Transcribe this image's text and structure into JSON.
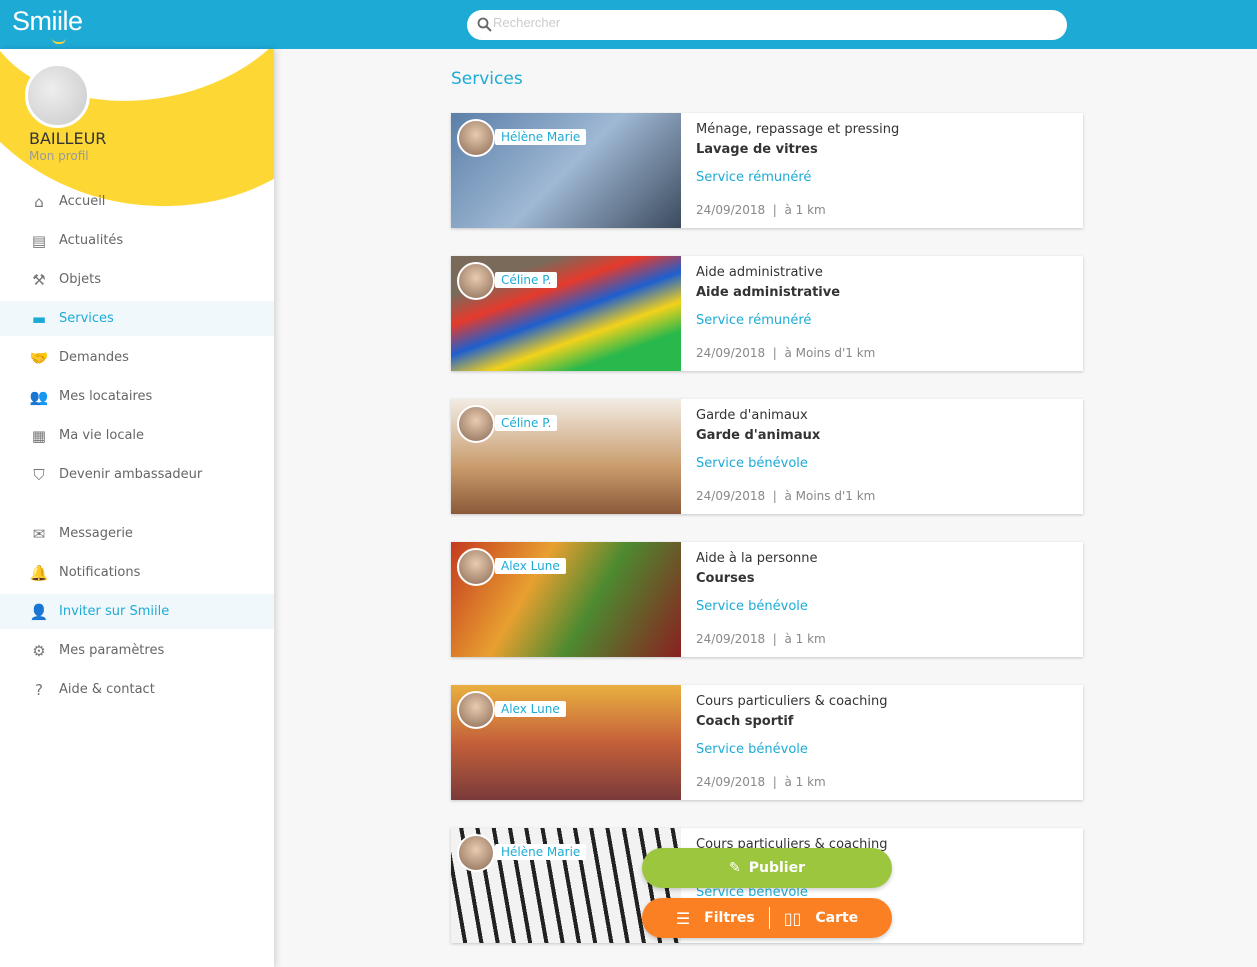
{
  "app": {
    "logo": "Smiile",
    "search_placeholder": "Rechercher"
  },
  "sidebar": {
    "role": "BAILLEUR",
    "profile_link": "Mon profil",
    "items": [
      {
        "label": "Accueil",
        "icon": "home-icon",
        "glyph": "⌂"
      },
      {
        "label": "Actualités",
        "icon": "newspaper-icon",
        "glyph": "▤"
      },
      {
        "label": "Objets",
        "icon": "tools-icon",
        "glyph": "⚒"
      },
      {
        "label": "Services",
        "icon": "paint-roller-icon",
        "glyph": "▬",
        "active": true
      },
      {
        "label": "Demandes",
        "icon": "handshake-icon",
        "glyph": "🤝"
      },
      {
        "label": "Mes locataires",
        "icon": "users-icon",
        "glyph": "👥"
      },
      {
        "label": "Ma vie locale",
        "icon": "store-icon",
        "glyph": "▦"
      },
      {
        "label": "Devenir ambassadeur",
        "icon": "shield-icon",
        "glyph": "⛉"
      },
      {
        "label": "Messagerie",
        "icon": "envelope-icon",
        "glyph": "✉"
      },
      {
        "label": "Notifications",
        "icon": "bell-icon",
        "glyph": "🔔"
      },
      {
        "label": "Inviter sur Smiile",
        "icon": "add-user-icon",
        "glyph": "👤",
        "active": true
      },
      {
        "label": "Mes paramètres",
        "icon": "gear-icon",
        "glyph": "⚙"
      },
      {
        "label": "Aide & contact",
        "icon": "question-icon",
        "glyph": "?"
      }
    ]
  },
  "main": {
    "title": "Services",
    "cards": [
      {
        "user": "Hélène Marie",
        "category": "Ménage, repassage et pressing",
        "service": "Lavage de vitres",
        "type": "Service rémunéré",
        "date": "24/09/2018",
        "distance": "à 1 km",
        "bg": "linear-gradient(135deg,#5b7fa8,#9fb8d4 50%,#3c4b5e)"
      },
      {
        "user": "Céline P.",
        "category": "Aide administrative",
        "service": "Aide administrative",
        "type": "Service rémunéré",
        "date": "24/09/2018",
        "distance": "à Moins d'1 km",
        "bg": "linear-gradient(160deg,#7a6a5a 20%,#e53a2c 35%,#1e5fcf 50%,#f2d21b 65%,#29b84c 80%)"
      },
      {
        "user": "Céline P.",
        "category": "Garde d'animaux",
        "service": "Garde d'animaux",
        "type": "Service bénévole",
        "date": "24/09/2018",
        "distance": "à Moins d'1 km",
        "bg": "linear-gradient(180deg,#f2ece4,#c89a6a 60%,#8a5a3a)"
      },
      {
        "user": "Alex Lune",
        "category": "Aide à la personne",
        "service": "Courses",
        "type": "Service bénévole",
        "date": "24/09/2018",
        "distance": "à 1 km",
        "bg": "linear-gradient(120deg,#c43a20,#e8a030 35%,#4d8a30 60%,#8a2020)"
      },
      {
        "user": "Alex Lune",
        "category": "Cours particuliers & coaching",
        "service": "Coach sportif",
        "type": "Service bénévole",
        "date": "24/09/2018",
        "distance": "à 1 km",
        "bg": "linear-gradient(180deg,#e9b040,#c4603a 50%,#7a3a3a)"
      },
      {
        "user": "Hélène Marie",
        "category": "Cours particuliers & coaching",
        "service": "",
        "type": "Service bénévole",
        "date": "",
        "distance": "",
        "bg": "repeating-linear-gradient(80deg,#f2f2f2 0 12px,#222 12px 16px)"
      }
    ]
  },
  "actions": {
    "publish": "Publier",
    "filters": "Filtres",
    "map": "Carte"
  },
  "colors": {
    "primary": "#1dabd6",
    "yellow": "#fdd835",
    "publish": "#9dc63f",
    "filters": "#fb8023"
  }
}
